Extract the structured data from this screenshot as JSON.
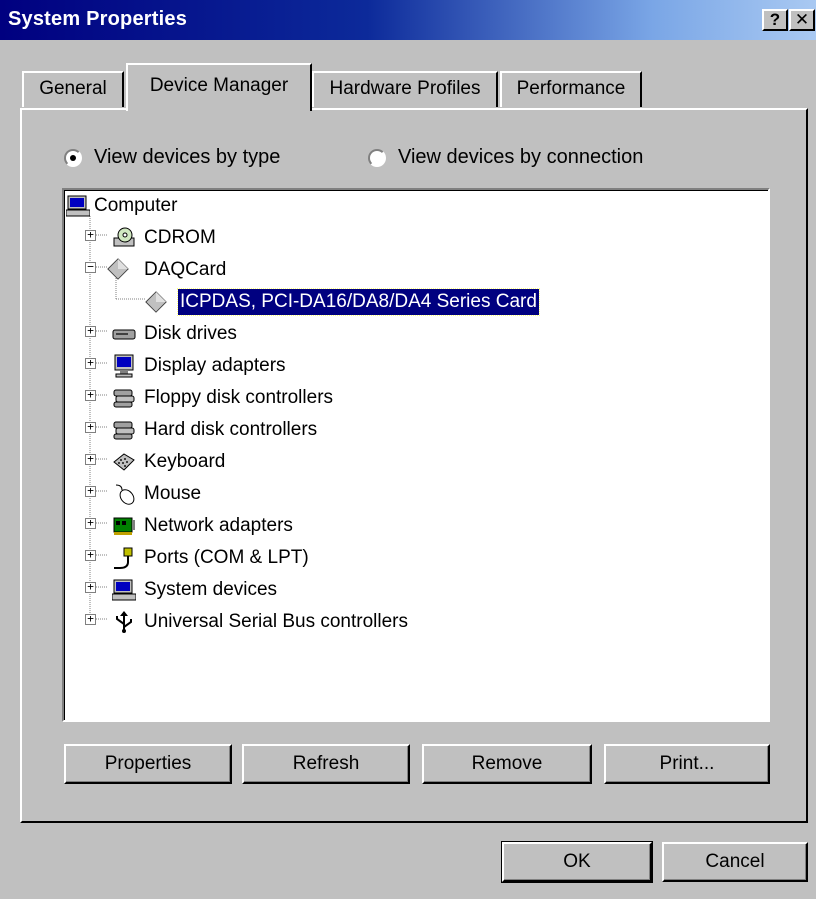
{
  "window": {
    "title": "System Properties",
    "help_btn": "?",
    "close_btn": "✕"
  },
  "tabs": [
    {
      "label": "General",
      "active": false
    },
    {
      "label": "Device Manager",
      "active": true
    },
    {
      "label": "Hardware Profiles",
      "active": false
    },
    {
      "label": "Performance",
      "active": false
    }
  ],
  "view_options": {
    "by_type": {
      "label": "View devices by type",
      "selected": true
    },
    "by_connection": {
      "label": "View devices by connection",
      "selected": false
    }
  },
  "tree": {
    "root": {
      "label": "Computer",
      "icon": "computer-icon"
    },
    "items": [
      {
        "label": "CDROM",
        "icon": "cdrom-icon",
        "expander": "+"
      },
      {
        "label": "DAQCard",
        "icon": "daq-diamond-icon",
        "expander": "−"
      },
      {
        "label": "ICPDAS, PCI-DA16/DA8/DA4 Series Card",
        "icon": "daq-diamond-icon",
        "selected": true
      },
      {
        "label": "Disk drives",
        "icon": "disk-drive-icon",
        "expander": "+"
      },
      {
        "label": "Display adapters",
        "icon": "monitor-icon",
        "expander": "+"
      },
      {
        "label": "Floppy disk controllers",
        "icon": "disk-controller-icon",
        "expander": "+"
      },
      {
        "label": "Hard disk controllers",
        "icon": "disk-controller-icon",
        "expander": "+"
      },
      {
        "label": "Keyboard",
        "icon": "keyboard-icon",
        "expander": "+"
      },
      {
        "label": "Mouse",
        "icon": "mouse-icon",
        "expander": "+"
      },
      {
        "label": "Network adapters",
        "icon": "network-card-icon",
        "expander": "+"
      },
      {
        "label": "Ports (COM & LPT)",
        "icon": "port-icon",
        "expander": "+"
      },
      {
        "label": "System devices",
        "icon": "computer-icon",
        "expander": "+"
      },
      {
        "label": "Universal Serial Bus controllers",
        "icon": "usb-icon",
        "expander": "+"
      }
    ]
  },
  "buttons": {
    "properties": "Properties",
    "refresh": "Refresh",
    "remove": "Remove",
    "print": "Print...",
    "ok": "OK",
    "cancel": "Cancel"
  },
  "colors": {
    "titlebar_start": "#000080",
    "titlebar_end": "#a9c9f2",
    "face": "#c0c0c0",
    "selection": "#000080"
  }
}
